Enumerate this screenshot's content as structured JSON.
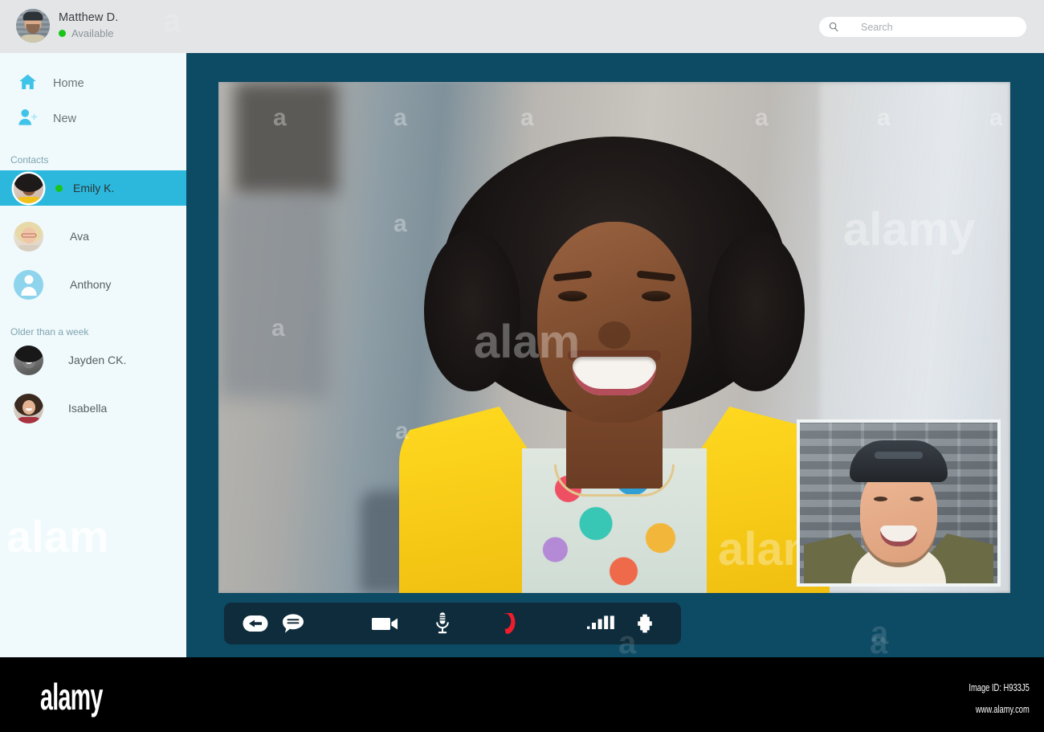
{
  "header": {
    "user_name": "Matthew D.",
    "status_text": "Available",
    "status_color": "#19c519",
    "avatar_name": "matthew-avatar"
  },
  "search": {
    "placeholder": "Search",
    "value": "",
    "icon": "search-icon"
  },
  "sidebar": {
    "nav": [
      {
        "label": "Home",
        "icon": "home-icon"
      },
      {
        "label": "New",
        "icon": "add-person-icon"
      }
    ],
    "sections": [
      {
        "label": "Contacts",
        "contacts": [
          {
            "name": "Emily K.",
            "selected": true,
            "online": true,
            "avatar": "photo-emily"
          },
          {
            "name": "Ava",
            "selected": false,
            "online": false,
            "avatar": "photo-ava"
          },
          {
            "name": "Anthony",
            "selected": false,
            "online": false,
            "avatar": "placeholder-person"
          }
        ]
      },
      {
        "label": "Older than a week",
        "contacts": [
          {
            "name": "Jayden CK.",
            "selected": false,
            "online": false,
            "avatar": "photo-jayden"
          },
          {
            "name": "Isabella",
            "selected": false,
            "online": false,
            "avatar": "photo-isabella"
          }
        ]
      }
    ]
  },
  "call": {
    "main_video_label": "remote-participant-video",
    "pip_label": "self-view-video",
    "controls": [
      {
        "name": "back-button",
        "icon": "back-arrow-icon",
        "color": "#ffffff"
      },
      {
        "name": "chat-button",
        "icon": "chat-bubble-icon",
        "color": "#ffffff"
      },
      {
        "name": "video-button",
        "icon": "video-camera-icon",
        "color": "#ffffff"
      },
      {
        "name": "mic-button",
        "icon": "microphone-icon",
        "color": "#ffffff"
      },
      {
        "name": "hangup-button",
        "icon": "hangup-phone-icon",
        "color": "#ef1d2c"
      },
      {
        "name": "signal-button",
        "icon": "signal-bars-icon",
        "color": "#ffffff"
      },
      {
        "name": "add-button",
        "icon": "plus-icon",
        "color": "#ffffff"
      }
    ]
  },
  "theme": {
    "header_bg": "#e3e5e7",
    "sidebar_bg": "#f0fafc",
    "accent_cyan": "#2cb8dd",
    "stage_bg": "#0d4a63",
    "controlbar_bg": "#0e2c3c",
    "hangup_red": "#ef1d2c"
  },
  "watermarks": {
    "letter": "a",
    "word": "alamy",
    "partial": "alam"
  },
  "footer": {
    "logo": "alamy",
    "image_id": "Image ID: H933J5",
    "website": "www.alamy.com"
  }
}
